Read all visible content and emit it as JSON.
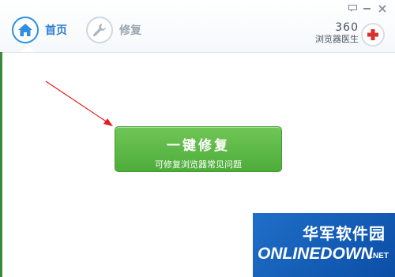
{
  "nav": {
    "home_label": "首页",
    "repair_label": "修复"
  },
  "brand": {
    "number": "360",
    "name": "浏览器医生"
  },
  "main": {
    "button_title": "一键修复",
    "button_subtitle": "可修复浏览器常见问题"
  },
  "watermark": {
    "chinese": "华军软件园",
    "english": "ONLINEDOWN",
    "suffix": ".NET"
  },
  "colors": {
    "accent_blue": "#2e8fe0",
    "button_green": "#5bb848",
    "logo_red": "#d9302c",
    "annotation_red": "#e02020"
  },
  "icons": {
    "home": "home-icon",
    "repair": "wrench-icon",
    "message": "message-icon",
    "minimize": "minimize-icon",
    "close": "close-icon",
    "doctor": "red-cross-icon"
  }
}
